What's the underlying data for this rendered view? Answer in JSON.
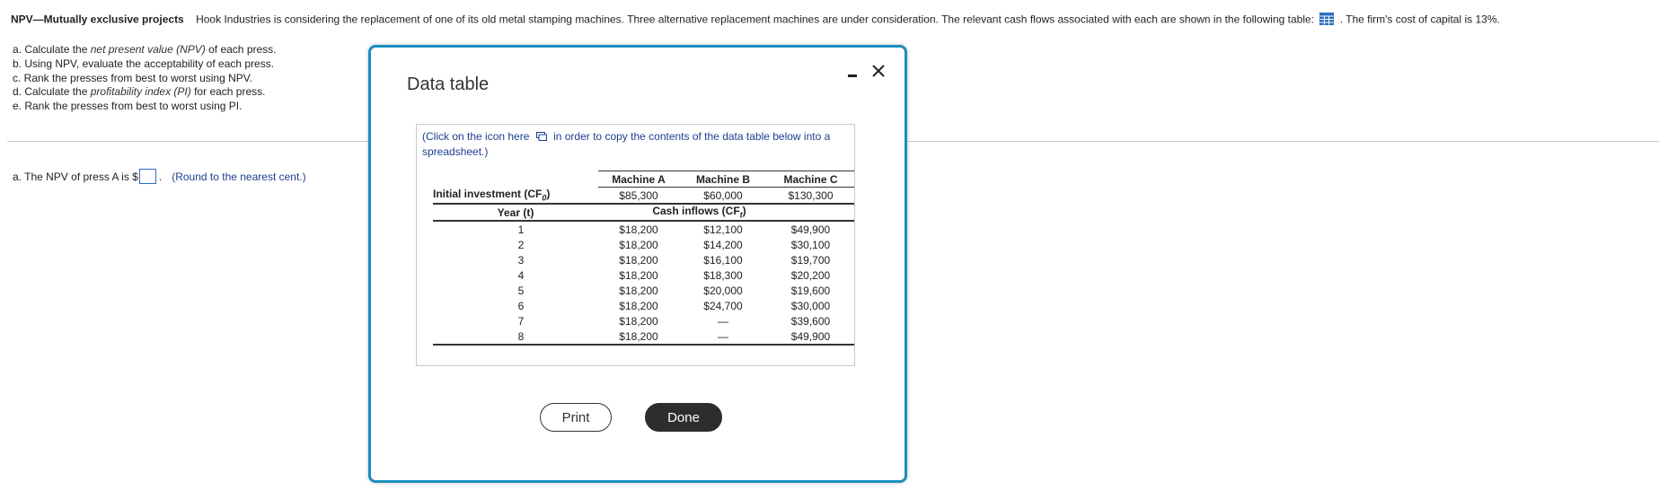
{
  "problem": {
    "title": "NPV—Mutually exclusive projects",
    "text": "Hook Industries is considering the replacement of one of its old metal stamping machines.  Three alternative replacement machines are under consideration.  The relevant cash flows associated with each are shown in the following table:",
    "after_icon": ".  The firm's cost of capital is 13%."
  },
  "parts": [
    {
      "pre": "a.  Calculate the ",
      "em": "net present value (NPV)",
      "post": " of each press."
    },
    {
      "pre": "b.  Using NPV, evaluate the acceptability of each press.",
      "em": "",
      "post": ""
    },
    {
      "pre": "c.  Rank the presses from best to worst using NPV.",
      "em": "",
      "post": ""
    },
    {
      "pre": "d.  Calculate the ",
      "em": "profitability index (PI)",
      "post": " for each press."
    },
    {
      "pre": "e.  Rank the presses from best to worst using PI.",
      "em": "",
      "post": ""
    }
  ],
  "answer": {
    "prefix": "a.  The NPV of press A is $",
    "value": "",
    "suffix": ".",
    "hint": "(Round to the nearest cent.)"
  },
  "modal": {
    "title": "Data table",
    "copy_note_pre": "(Click on the icon here",
    "copy_note_post": "in order to copy the contents of the data table below into a spreadsheet.)",
    "print_label": "Print",
    "done_label": "Done"
  },
  "table": {
    "headers": [
      "Machine A",
      "Machine B",
      "Machine C"
    ],
    "investment_label": "Initial investment (CF",
    "investment_sub": "0",
    "investment": [
      "$85,300",
      "$60,000",
      "$130,300"
    ],
    "year_label": "Year (t)",
    "cash_label": "Cash inflows (CF",
    "cash_sub": "t",
    "rows": [
      {
        "year": "1",
        "a": "$18,200",
        "b": "$12,100",
        "c": "$49,900"
      },
      {
        "year": "2",
        "a": "$18,200",
        "b": "$14,200",
        "c": "$30,100"
      },
      {
        "year": "3",
        "a": "$18,200",
        "b": "$16,100",
        "c": "$19,700"
      },
      {
        "year": "4",
        "a": "$18,200",
        "b": "$18,300",
        "c": "$20,200"
      },
      {
        "year": "5",
        "a": "$18,200",
        "b": "$20,000",
        "c": "$19,600"
      },
      {
        "year": "6",
        "a": "$18,200",
        "b": "$24,700",
        "c": "$30,000"
      },
      {
        "year": "7",
        "a": "$18,200",
        "b": "—",
        "c": "$39,600"
      },
      {
        "year": "8",
        "a": "$18,200",
        "b": "—",
        "c": "$49,900"
      }
    ]
  },
  "colors": {
    "modal_border": "#1b8fbf",
    "hint_text": "#1b3f8e",
    "table_icon": "#2a6ebb"
  },
  "icons": {
    "table_icon": "grid-table-icon",
    "copy_icon": "copy-icon",
    "minimize": "minimize-icon",
    "close": "close-icon"
  }
}
